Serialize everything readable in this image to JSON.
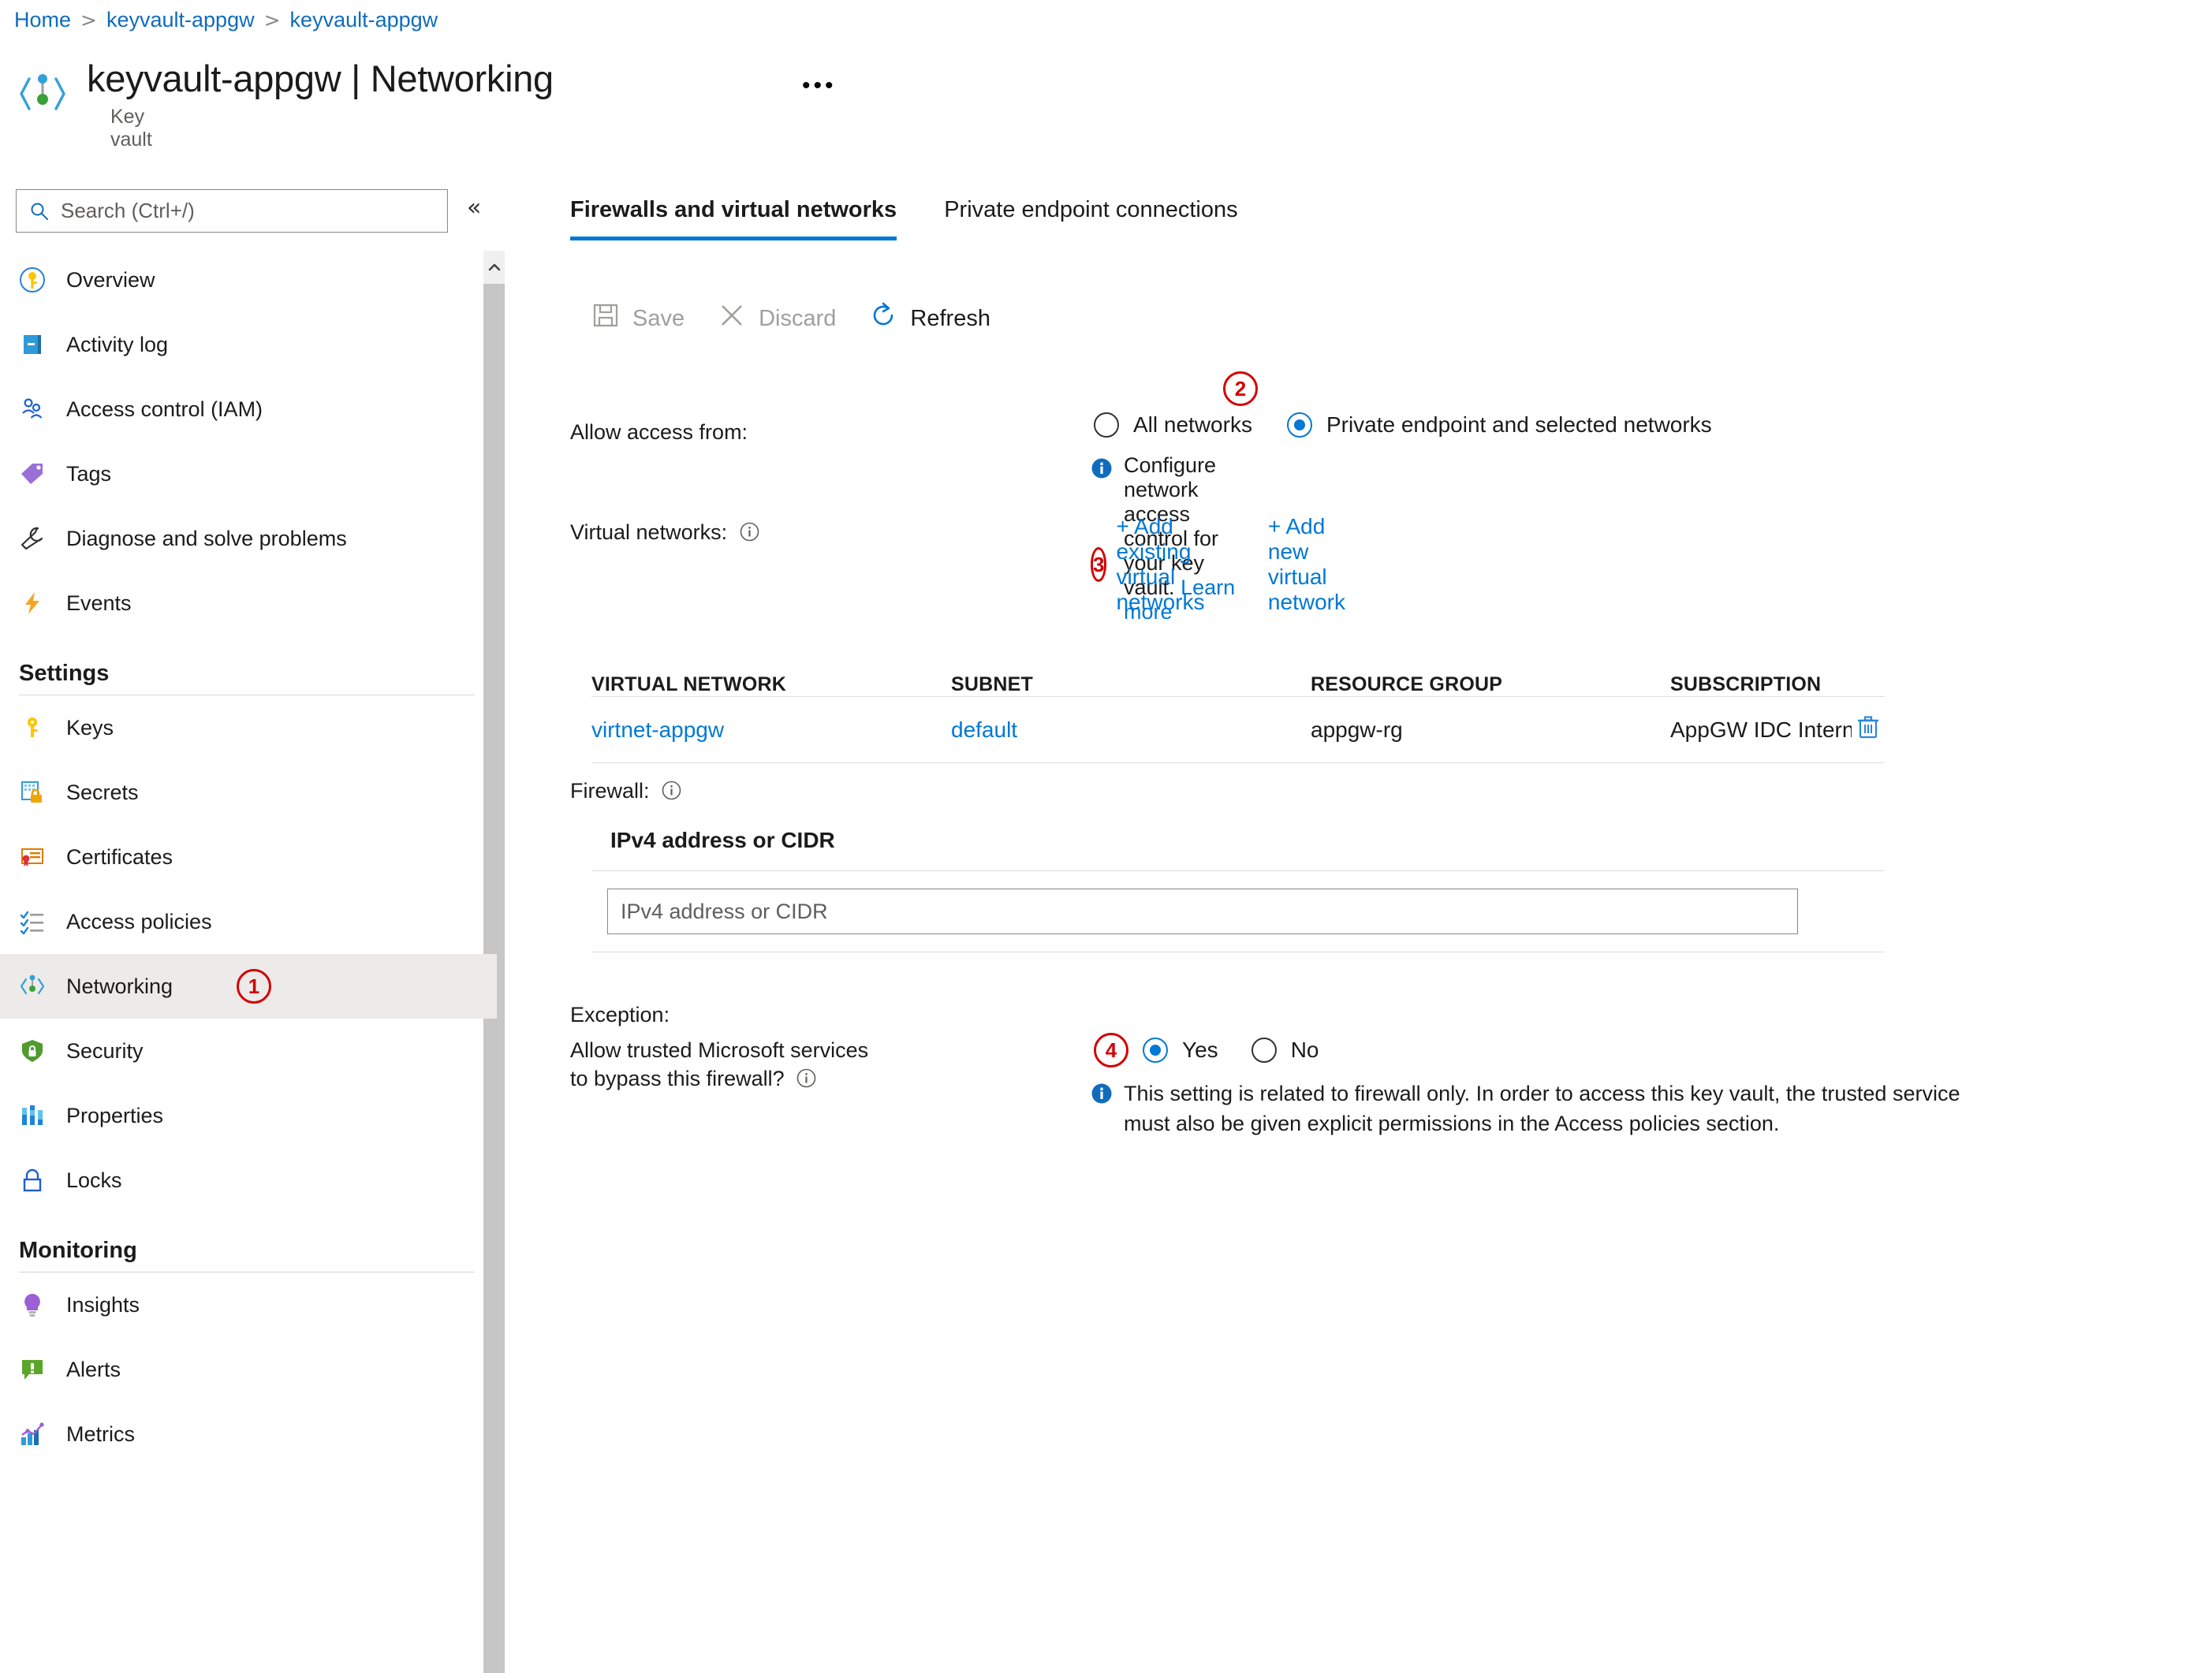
{
  "breadcrumb": {
    "items": [
      "Home",
      "keyvault-appgw",
      "keyvault-appgw"
    ],
    "separator": ">"
  },
  "header": {
    "title": "keyvault-appgw | Networking",
    "subtitle": "Key vault",
    "more_menu": "•••"
  },
  "sidebar": {
    "search_placeholder": "Search (Ctrl+/)",
    "search_value": "",
    "collapse_label": "«",
    "items": [
      {
        "label": "Overview",
        "icon": "key-circle-icon",
        "selected": false
      },
      {
        "label": "Activity log",
        "icon": "activity-log-icon",
        "selected": false
      },
      {
        "label": "Access control (IAM)",
        "icon": "people-icon",
        "selected": false
      },
      {
        "label": "Tags",
        "icon": "tag-icon",
        "selected": false
      },
      {
        "label": "Diagnose and solve problems",
        "icon": "wrench-icon",
        "selected": false
      },
      {
        "label": "Events",
        "icon": "lightning-icon",
        "selected": false
      }
    ],
    "settings_section": {
      "title": "Settings",
      "items": [
        {
          "label": "Keys",
          "icon": "key-icon",
          "selected": false
        },
        {
          "label": "Secrets",
          "icon": "secret-lock-icon",
          "selected": false
        },
        {
          "label": "Certificates",
          "icon": "certificate-icon",
          "selected": false
        },
        {
          "label": "Access policies",
          "icon": "checklist-icon",
          "selected": false
        },
        {
          "label": "Networking",
          "icon": "networking-icon",
          "selected": true,
          "badge": "1"
        },
        {
          "label": "Security",
          "icon": "shield-lock-icon",
          "selected": false
        },
        {
          "label": "Properties",
          "icon": "properties-bars-icon",
          "selected": false
        },
        {
          "label": "Locks",
          "icon": "padlock-icon",
          "selected": false
        }
      ]
    },
    "monitoring_section": {
      "title": "Monitoring",
      "items": [
        {
          "label": "Insights",
          "icon": "lightbulb-icon",
          "selected": false
        },
        {
          "label": "Alerts",
          "icon": "alert-icon",
          "selected": false
        },
        {
          "label": "Metrics",
          "icon": "metrics-chart-icon",
          "selected": false
        }
      ]
    }
  },
  "main": {
    "tabs": [
      {
        "label": "Firewalls and virtual networks",
        "active": true
      },
      {
        "label": "Private endpoint connections",
        "active": false
      }
    ],
    "toolbar": [
      {
        "label": "Save",
        "icon": "save-icon",
        "enabled": false
      },
      {
        "label": "Discard",
        "icon": "discard-x-icon",
        "enabled": false
      },
      {
        "label": "Refresh",
        "icon": "refresh-icon",
        "enabled": true
      }
    ],
    "allow_access": {
      "label": "Allow access from:",
      "options": [
        {
          "label": "All networks",
          "selected": false
        },
        {
          "label": "Private endpoint and selected networks",
          "selected": true,
          "badge": "2"
        }
      ],
      "info_text": "Configure network access control for your key vault.",
      "info_link": "Learn more"
    },
    "virtual_networks": {
      "label": "Virtual networks:",
      "add_existing_label": "+ Add existing virtual networks",
      "add_existing_badge": "3",
      "add_new_label": "+ Add new virtual network",
      "columns": [
        "VIRTUAL NETWORK",
        "SUBNET",
        "RESOURCE GROUP",
        "SUBSCRIPTION"
      ],
      "rows": [
        {
          "virtual_network": "virtnet-appgw",
          "subnet": "default",
          "resource_group": "appgw-rg",
          "subscription": "AppGW IDC Internal Subscr...",
          "delete_icon": "trash-icon"
        }
      ]
    },
    "firewall": {
      "label": "Firewall:",
      "card_header": "IPv4 address or CIDR",
      "input_placeholder": "IPv4 address or CIDR",
      "input_value": ""
    },
    "exception": {
      "label": "Exception:",
      "question": "Allow trusted Microsoft services to bypass this firewall?",
      "options": [
        {
          "label": "Yes",
          "selected": true,
          "badge": "4"
        },
        {
          "label": "No",
          "selected": false
        }
      ],
      "info_text": "This setting is related to firewall only. In order to access this key vault, the trusted service must also be given explicit permissions in the Access policies section."
    }
  },
  "colors": {
    "accent": "#0078d4",
    "link": "#0078d4",
    "annotation": "#d40000",
    "selected_bg": "#edebe9",
    "text": "#1b1b1b",
    "muted": "#605e5c"
  }
}
